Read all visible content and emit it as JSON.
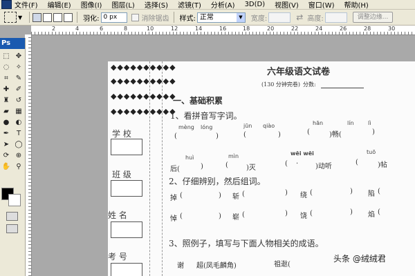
{
  "menu": [
    "文件(F)",
    "编辑(E)",
    "图像(I)",
    "图层(L)",
    "选择(S)",
    "滤镜(T)",
    "分析(A)",
    "3D(D)",
    "视图(V)",
    "窗口(W)",
    "帮助(H)"
  ],
  "options": {
    "feather_label": "羽化:",
    "feather_value": "0 px",
    "antialias_label": "消除锯齿",
    "style_label": "样式:",
    "style_value": "正常",
    "width_label": "宽度:",
    "height_label": "高度:",
    "refine_edge": "调整边缘..."
  },
  "toolbox": {
    "logo": "Ps",
    "foreground_color": "#000000",
    "background_color": "#ffffff"
  },
  "ruler_numbers": [
    "2",
    "4",
    "6",
    "8",
    "10",
    "12",
    "14",
    "16",
    "18",
    "20",
    "22",
    "24",
    "26",
    "28",
    "30"
  ],
  "document": {
    "title": "六年级语文试卷",
    "subtitle": "(130 分钟完卷)",
    "score_label": "分数:",
    "side_labels": [
      "学 校",
      "班 级",
      "姓 名",
      "考 号"
    ],
    "section1": "一、基础积累",
    "q1": "1、看拼音写字词。",
    "pinyin_row1": [
      "mèng",
      "lóng",
      "jūn",
      "qiào",
      "hān",
      "lín",
      "lì"
    ],
    "row1_text": ")畅(",
    "pinyin_row2": [
      "huì",
      "mìn",
      "wēi wēi",
      "tuō"
    ],
    "row2_texts": [
      "后(",
      ")灭",
      ")动听",
      ")帖"
    ],
    "q2": "2、仔细辨别，然后组词。",
    "q2_row1": [
      "掉",
      "斩",
      "绕",
      "陷"
    ],
    "q2_row2": [
      "悼",
      "崭",
      "饶",
      "焰"
    ],
    "q3": "3、照例子，填写与下面人物相关的成语。",
    "q3_row": [
      "谢",
      "超(凤毛麟角)",
      "祖逖("
    ]
  },
  "watermark": "头条 @绒绒君"
}
